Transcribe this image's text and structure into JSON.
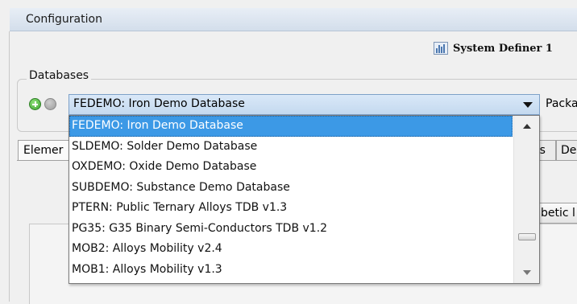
{
  "window": {
    "title": "Configuration"
  },
  "system_definer": {
    "icon": "system-definer-icon",
    "label": "System Definer 1"
  },
  "databases": {
    "group_label": "Databases",
    "add_icon": "add-circle-icon",
    "remove_icon": "remove-circle-icon",
    "selected": "FEDEMO: Iron Demo Database",
    "packages_label": "Packa",
    "options": [
      "FEDEMO: Iron Demo Database",
      "SLDEMO: Solder Demo Database",
      "OXDEMO: Oxide Demo Database",
      "SUBDEMO: Substance Demo Database",
      "PTERN: Public Ternary Alloys TDB v1.3",
      "PG35: G35 Binary Semi-Conductors TDB v1.2",
      "MOB2: Alloys Mobility  v2.4",
      "MOB1: Alloys Mobility  v1.3"
    ]
  },
  "tabs": {
    "elements": "Elemer",
    "es": "es",
    "de": "De"
  },
  "buttons": {
    "alphabetic": "betic l"
  },
  "colors": {
    "selection": "#3c99e6",
    "combo": "#c4d9ef",
    "titlebar": "#d3deeb"
  }
}
